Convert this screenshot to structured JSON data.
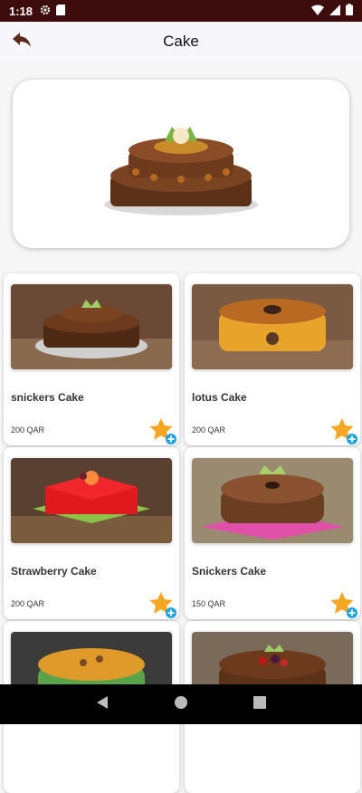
{
  "status_bar": {
    "time": "1:18"
  },
  "app_bar": {
    "title": "Cake"
  },
  "products": [
    {
      "name": "snickers Cake",
      "price": "200 QAR"
    },
    {
      "name": "lotus Cake",
      "price": "200 QAR"
    },
    {
      "name": "Strawberry Cake",
      "price": "200 QAR"
    },
    {
      "name": "Snickers Cake",
      "price": "150 QAR"
    },
    {
      "name": "",
      "price": ""
    },
    {
      "name": "",
      "price": ""
    }
  ],
  "icons": {
    "back": "back-arrow-icon",
    "favorite": "star-add-icon",
    "nav_back": "triangle-back-icon",
    "nav_home": "circle-home-icon",
    "nav_recents": "square-recents-icon"
  },
  "colors": {
    "status_bar": "#3d0d0d",
    "app_bar": "#f7f7fb",
    "star": "#f5a623",
    "plus_badge": "#1aa3e0"
  }
}
